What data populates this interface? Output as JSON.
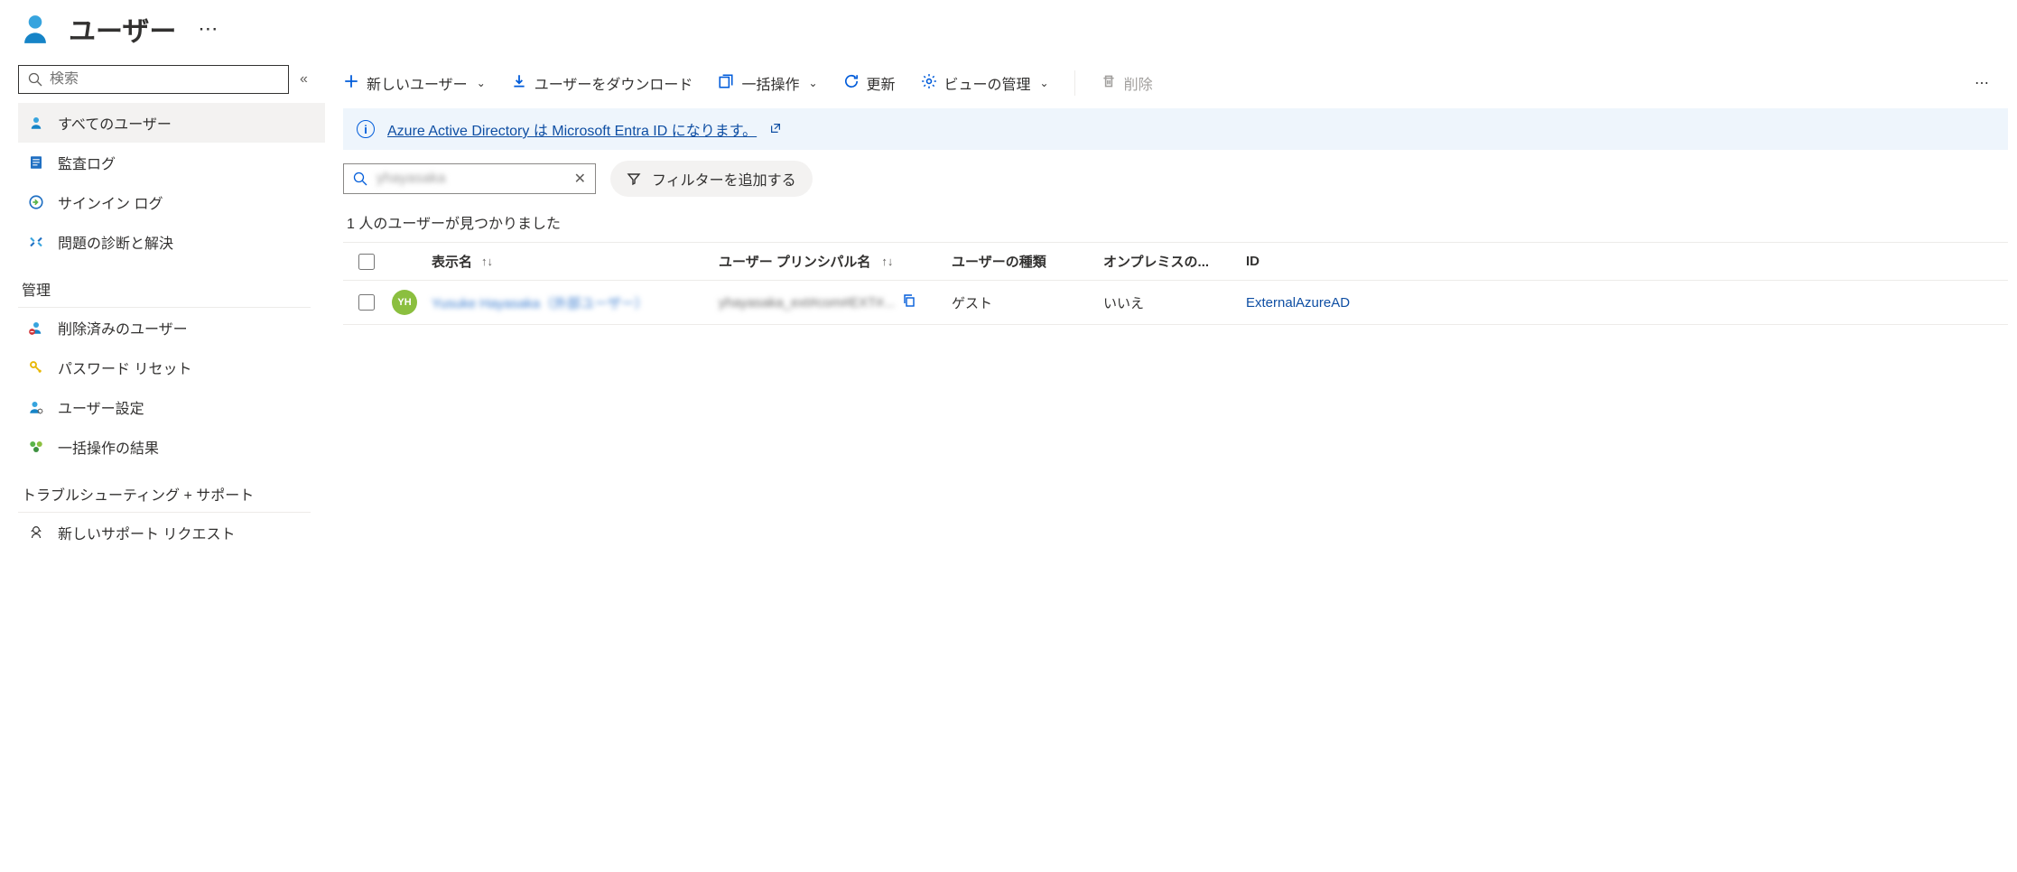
{
  "header": {
    "title": "ユーザー"
  },
  "sidebar": {
    "search_placeholder": "検索",
    "items": [
      {
        "label": "すべてのユーザー"
      },
      {
        "label": "監査ログ"
      },
      {
        "label": "サインイン ログ"
      },
      {
        "label": "問題の診断と解決"
      }
    ],
    "sections": {
      "manage": "管理",
      "support": "トラブルシューティング + サポート"
    },
    "manage_items": [
      {
        "label": "削除済みのユーザー"
      },
      {
        "label": "パスワード リセット"
      },
      {
        "label": "ユーザー設定"
      },
      {
        "label": "一括操作の結果"
      }
    ],
    "support_items": [
      {
        "label": "新しいサポート リクエスト"
      }
    ]
  },
  "toolbar": {
    "new_user": "新しいユーザー",
    "download": "ユーザーをダウンロード",
    "bulk": "一括操作",
    "refresh": "更新",
    "manage_view": "ビューの管理",
    "delete": "削除"
  },
  "banner": {
    "text": "Azure Active Directory は Microsoft Entra ID になります。"
  },
  "main": {
    "search_value": "yhayasaka",
    "filter_label": "フィルターを追加する",
    "result_count": "1 人のユーザーが見つかりました"
  },
  "table": {
    "headers": {
      "display_name": "表示名",
      "upn": "ユーザー プリンシパル名",
      "type": "ユーザーの種類",
      "onprem": "オンプレミスの...",
      "id": "ID"
    },
    "rows": [
      {
        "avatar_initials": "YH",
        "display_name": "Yusuke Hayasaka（外部ユーザー）",
        "upn": "yhayasaka_ext#com#EXT#...",
        "type": "ゲスト",
        "onprem": "いいえ",
        "id": "ExternalAzureAD"
      }
    ]
  }
}
